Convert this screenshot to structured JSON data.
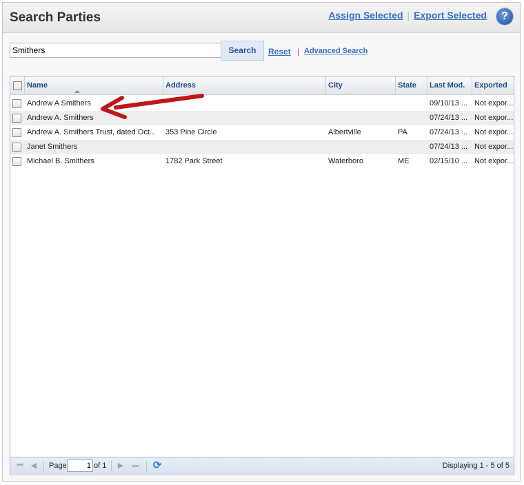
{
  "header": {
    "title": "Search Parties",
    "assign_label": "Assign Selected",
    "export_label": "Export Selected",
    "help_glyph": "?"
  },
  "search": {
    "value": "Smithers",
    "button_label": "Search",
    "reset_label": "Reset",
    "separator": "|",
    "advanced_label": "Advanced Search"
  },
  "grid": {
    "columns": [
      "Name",
      "Address",
      "City",
      "State",
      "Last Mod.",
      "Exported"
    ],
    "sort_column": "Name",
    "rows": [
      {
        "name": "Andrew A Smithers",
        "address": "",
        "city": "",
        "state": "",
        "last_mod": "09/10/13 ...",
        "exported": "Not expor..."
      },
      {
        "name": "Andrew A. Smithers",
        "address": "",
        "city": "",
        "state": "",
        "last_mod": "07/24/13 ...",
        "exported": "Not expor..."
      },
      {
        "name": "Andrew A. Smithers Trust, dated Oct...",
        "address": "353 Pine Circle",
        "city": "Albertville",
        "state": "PA",
        "last_mod": "07/24/13 ...",
        "exported": "Not expor..."
      },
      {
        "name": "Janet Smithers",
        "address": "",
        "city": "",
        "state": "",
        "last_mod": "07/24/13 ...",
        "exported": "Not expor..."
      },
      {
        "name": "Michael B. Smithers",
        "address": "1782 Park Street",
        "city": "Waterboro",
        "state": "ME",
        "last_mod": "02/15/10 ...",
        "exported": "Not expor..."
      }
    ]
  },
  "pager": {
    "page_label": "Page",
    "current_page": "1",
    "of_label": "of 1",
    "displaying": "Displaying 1 - 5 of 5"
  },
  "colors": {
    "link": "#3a73c4",
    "header_text": "#1e4e8c",
    "annotation_arrow": "#c0161c"
  },
  "icons": [
    "help-icon",
    "first-page-icon",
    "prev-page-icon",
    "next-page-icon",
    "last-page-icon",
    "refresh-icon",
    "sort-ascending-icon",
    "annotation-arrow-icon"
  ]
}
